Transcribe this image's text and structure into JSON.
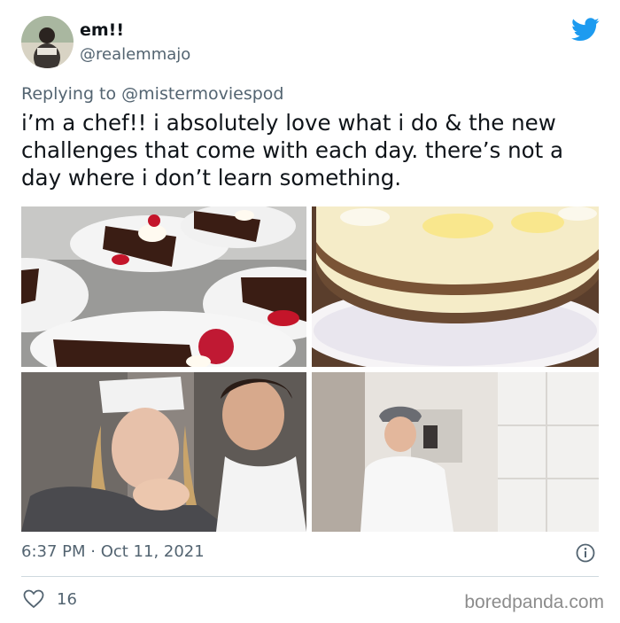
{
  "user": {
    "display_name": "em!!",
    "handle": "@realemmajo",
    "avatar_icon": "avatar-photo"
  },
  "brand_icon": "twitter-bird-icon",
  "brand_color": "#1d9bf0",
  "reply": {
    "prefix": "Replying to",
    "mention": "@mistermoviespod"
  },
  "tweet": {
    "text": "i’m a chef!! i absolutely love what i do & the new challenges that come with each day. there’s not a day where i don’t learn something."
  },
  "photos": [
    {
      "subject": "chocolate cake slices with raspberries"
    },
    {
      "subject": "lemon cheesecake on doily"
    },
    {
      "subject": "two chefs selfie"
    },
    {
      "subject": "chef mirror selfie"
    }
  ],
  "meta": {
    "timestamp": "6:37 PM · Oct 11, 2021",
    "info_icon": "info-icon"
  },
  "actions": {
    "like_icon": "heart-icon",
    "like_count": "16"
  },
  "watermark": "boredpanda.com"
}
